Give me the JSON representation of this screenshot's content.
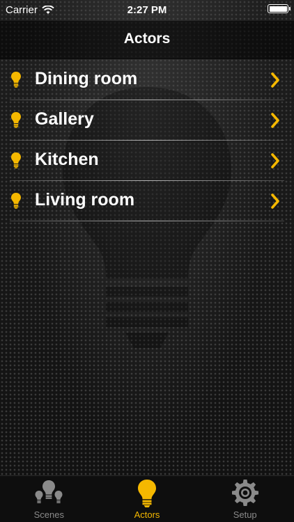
{
  "status_bar": {
    "carrier": "Carrier",
    "time": "2:27 PM"
  },
  "nav": {
    "title": "Actors"
  },
  "actors": [
    {
      "label": "Dining room"
    },
    {
      "label": "Gallery"
    },
    {
      "label": "Kitchen"
    },
    {
      "label": "Living room"
    }
  ],
  "tabs": [
    {
      "label": "Scenes",
      "icon": "scenes-bulbs-icon",
      "active": false
    },
    {
      "label": "Actors",
      "icon": "bulb-icon",
      "active": true
    },
    {
      "label": "Setup",
      "icon": "gear-icon",
      "active": false
    }
  ],
  "colors": {
    "accent": "#f5b800",
    "inactive": "#8a8a8a",
    "text": "#ffffff"
  }
}
